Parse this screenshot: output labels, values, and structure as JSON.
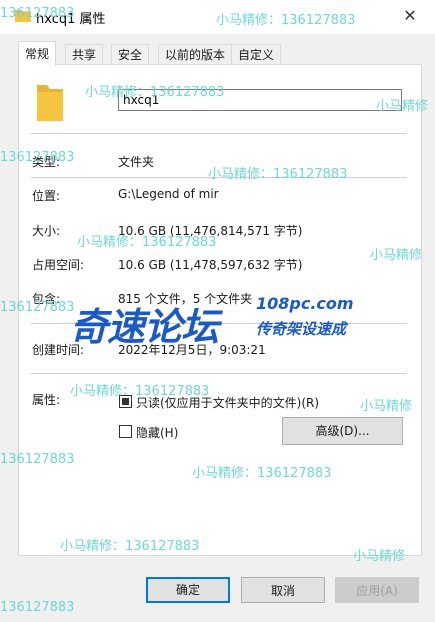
{
  "window": {
    "title": "hxcq1 属性",
    "close_glyph": "✕"
  },
  "tabs": [
    "常规",
    "共享",
    "安全",
    "以前的版本",
    "自定义"
  ],
  "general": {
    "folder_name": "hxcq1",
    "type_label": "类型:",
    "type_value": "文件夹",
    "location_label": "位置:",
    "location_value": "G:\\Legend of mir",
    "size_label": "大小:",
    "size_value": "10.6 GB (11,476,814,571 字节)",
    "disk_label": "占用空间:",
    "disk_value": "10.6 GB (11,478,597,632 字节)",
    "contains_label": "包含:",
    "contains_value": "815 个文件，5 个文件夹",
    "created_label": "创建时间:",
    "created_value": "2022年12月5日，9:03:21",
    "attr_label": "属性:",
    "readonly_label": "只读(仅应用于文件夹中的文件)(R)",
    "hidden_label": "隐藏(H)",
    "advanced_label": "高级(D)..."
  },
  "footer": {
    "ok": "确定",
    "cancel": "取消",
    "apply": "应用(A)"
  },
  "watermark": {
    "text_a": "小马精修：136127883",
    "text_b": "136127883",
    "text_c": "小马精修",
    "logo_main": "奇速论坛",
    "logo_site": "108pc.com",
    "logo_sub": "传奇架设速成",
    "color": "#5fd3d3",
    "logo_color": "#1b59c4"
  },
  "colors": {
    "accent": "#0078d7",
    "folder": "#f5c542"
  }
}
